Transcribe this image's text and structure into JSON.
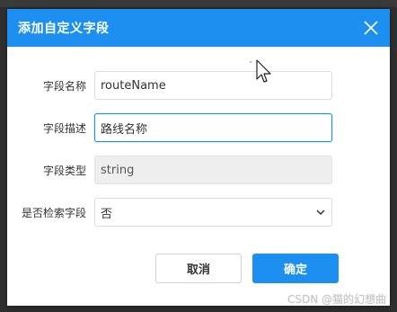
{
  "dialog": {
    "title": "添加自定义字段",
    "close_icon": "close-icon",
    "accent_color": "#1d8ff0"
  },
  "form": {
    "field_name": {
      "label": "字段名称",
      "value": "routeName"
    },
    "field_desc": {
      "label": "字段描述",
      "value": "路线名称"
    },
    "field_type": {
      "label": "字段类型",
      "value": "string"
    },
    "is_search": {
      "label": "是否检索字段",
      "selected": "否",
      "icon": "chevron-down-icon"
    }
  },
  "buttons": {
    "cancel_label": "取消",
    "ok_label": "确定"
  },
  "watermark": "CSDN @猫的幻想曲"
}
